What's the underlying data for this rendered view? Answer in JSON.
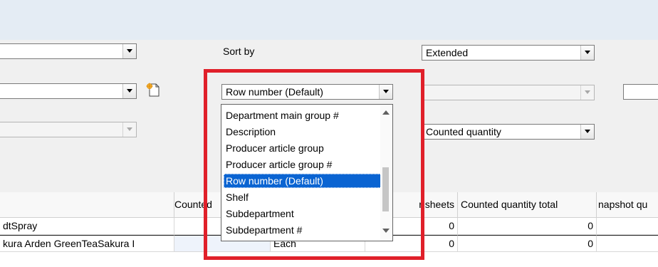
{
  "window": {
    "title": ""
  },
  "filters": {
    "sort_by_label": "Sort by",
    "sort_by_value": "Row number (Default)",
    "extended_value": "Extended",
    "counted_quantity_value": "Counted quantity",
    "left_combo_1_value": "",
    "left_combo_2_value": "",
    "left_combo_3_value": "",
    "right_combo_value": "",
    "far_right_field_value": ""
  },
  "dropdown": {
    "options": [
      "Department main group #",
      "Description",
      "Producer article group",
      "Producer article group #",
      "Row number (Default)",
      "Shelf",
      "Subdepartment",
      "Subdepartment #"
    ],
    "selected_index": 4
  },
  "grid": {
    "columns": [
      "",
      "Counted",
      "r sheets",
      "Counted quantity total",
      "napshot qu"
    ],
    "rows": [
      {
        "description": "dtSpray",
        "unit": "",
        "sheets": "0",
        "total": "0"
      },
      {
        "description": "kura Arden GreenTeaSakura I",
        "unit": "Each",
        "sheets": "0",
        "total": "0"
      }
    ]
  },
  "colors": {
    "highlight": "#e0202a",
    "selection": "#0a64d2"
  },
  "icons": {
    "new_document": "new-document-icon"
  }
}
